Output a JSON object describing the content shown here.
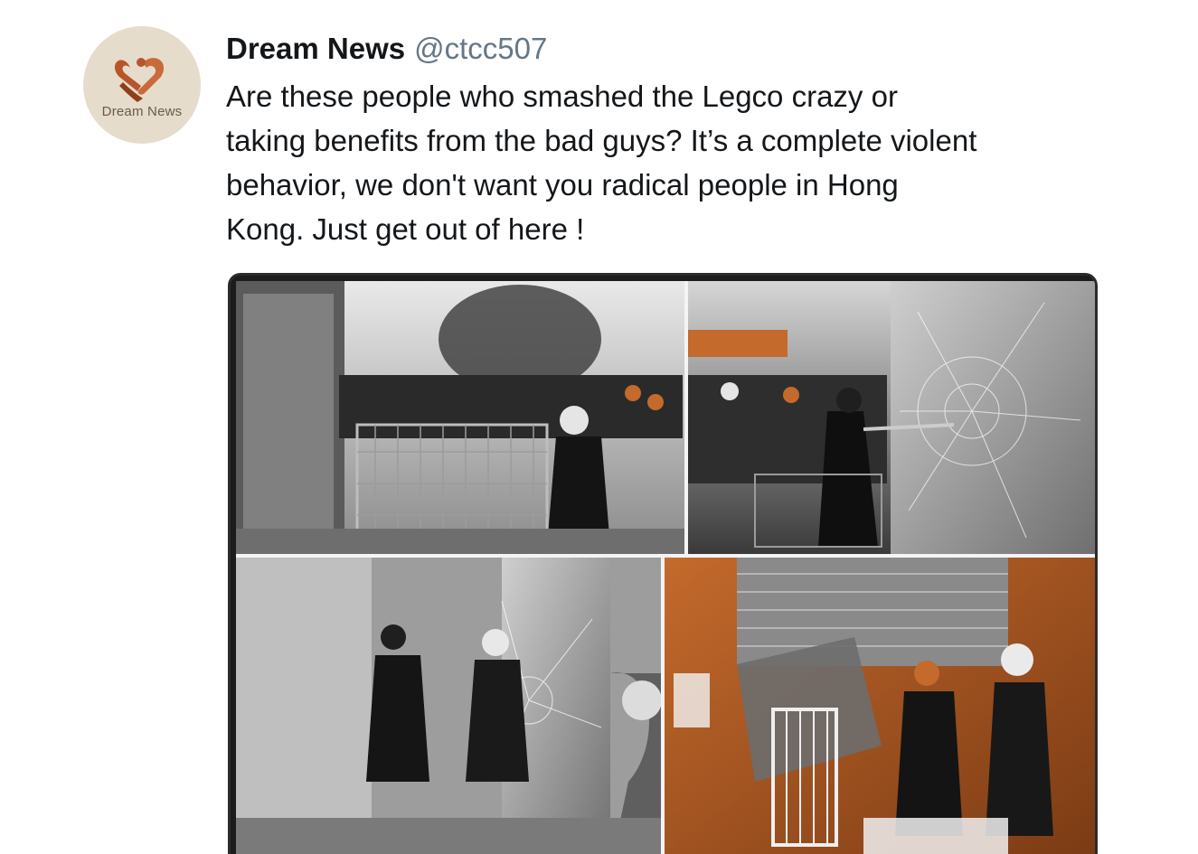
{
  "tweet": {
    "avatar_label": "Dream News",
    "display_name": "Dream News",
    "handle": "@ctcc507",
    "text": "Are these people who smashed the Legco crazy or\ntaking benefits from the bad guys? It’s a complete violent\nbehavior, we don't want you radical people in Hong\nKong. Just get out of here !"
  },
  "colors": {
    "avatar_bg": "#e6dccb",
    "avatar_logo": "#b8552a",
    "accent_orange": "#b85a22",
    "name_text": "#14171a",
    "handle_text": "#657786"
  },
  "icons": {
    "avatar_logo": "heart-hands-logo"
  }
}
